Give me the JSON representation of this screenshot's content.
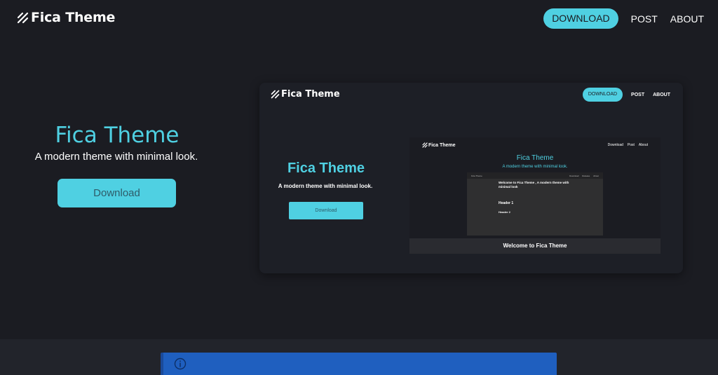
{
  "nav": {
    "brand": "Fica Theme",
    "download_label": "DOWNLOAD",
    "post_label": "POST",
    "about_label": "ABOUT"
  },
  "hero": {
    "title": "Fica Theme",
    "subtitle": "A modern theme with minimal look.",
    "button_label": "Download"
  },
  "preview": {
    "brand": "Fica Theme",
    "download_label": "DOWNLOAD",
    "post_label": "POST",
    "about_label": "ABOUT",
    "title": "Fica Theme",
    "subtitle": "A modern theme with minimal look.",
    "button_label": "Download",
    "screenshot": {
      "brand": "Fica Theme",
      "nav": [
        "Download",
        "Post",
        "About"
      ],
      "title": "Fica Theme",
      "subtitle": "A modern theme with minimal look.",
      "doc_brand": "Fica Theme",
      "doc_nav": [
        "Download",
        "Release",
        "About"
      ],
      "doc_heading": "Welcome to Fica Theme , A modern theme with minimal look",
      "doc_header1": "Header 1",
      "doc_header2": "Header 2",
      "footer_title": "Welcome to Fica Theme"
    }
  },
  "colors": {
    "background": "#1b1c22",
    "accent": "#4fd0e2",
    "alert": "#1f5fbf"
  },
  "icons": {
    "logo": "stripes-logo-icon",
    "alert": "info-circle-icon"
  }
}
